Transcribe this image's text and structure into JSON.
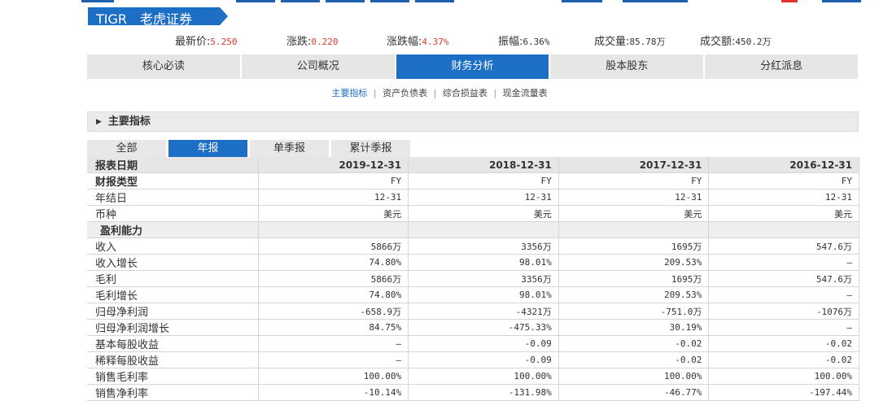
{
  "colors": {
    "accent": "#1d6ec5",
    "negative_red": "#e0392c",
    "tab_grey": "#e6e6e6"
  },
  "stock": {
    "symbol": "TIGR",
    "name": "老虎证券"
  },
  "quote": {
    "latest_label": "最新价:",
    "latest_value": "5.250",
    "change_label": "涨跌:",
    "change_value": "0.220",
    "pct_label": "涨跌幅:",
    "pct_value": "4.37%",
    "amplitude_label": "振幅:",
    "amplitude_value": "6.36%",
    "volume_label": "成交量:",
    "volume_value": "85.78万",
    "turnover_label": "成交额:",
    "turnover_value": "450.2万"
  },
  "nav": {
    "tabs": [
      "核心必读",
      "公司概况",
      "财务分析",
      "股本股东",
      "分红派息"
    ],
    "active": 2
  },
  "subnav": {
    "items": [
      "主要指标",
      "资产负债表",
      "综合损益表",
      "现金流量表"
    ],
    "separator": "|"
  },
  "section": {
    "title": "主要指标",
    "icon": "triangle-right-icon"
  },
  "period_tabs": [
    "全部",
    "年报",
    "单季报",
    "累计季报"
  ],
  "table": {
    "header": {
      "label": "报表日期",
      "cols": [
        "2019-12-31",
        "2018-12-31",
        "2017-12-31",
        "2016-12-31"
      ]
    },
    "rows": [
      {
        "label": "财报类型",
        "values": [
          "FY",
          "FY",
          "FY",
          "FY"
        ],
        "bold": true
      },
      {
        "label": "年结日",
        "values": [
          "12-31",
          "12-31",
          "12-31",
          "12-31"
        ]
      },
      {
        "label": "币种",
        "values": [
          "美元",
          "美元",
          "美元",
          "美元"
        ]
      },
      {
        "label": "盈利能力",
        "group": true
      },
      {
        "label": "收入",
        "values": [
          "5866万",
          "3356万",
          "1695万",
          "547.6万"
        ]
      },
      {
        "label": "收入增长",
        "values": [
          "74.80%",
          "98.01%",
          "209.53%",
          "—"
        ]
      },
      {
        "label": "毛利",
        "values": [
          "5866万",
          "3356万",
          "1695万",
          "547.6万"
        ]
      },
      {
        "label": "毛利增长",
        "values": [
          "74.80%",
          "98.01%",
          "209.53%",
          "—"
        ]
      },
      {
        "label": "归母净利润",
        "values": [
          "-658.9万",
          "-4321万",
          "-751.0万",
          "-1076万"
        ]
      },
      {
        "label": "归母净利润增长",
        "values": [
          "84.75%",
          "-475.33%",
          "30.19%",
          "—"
        ]
      },
      {
        "label": "基本每股收益",
        "values": [
          "—",
          "-0.09",
          "-0.02",
          "-0.02"
        ]
      },
      {
        "label": "稀释每股收益",
        "values": [
          "—",
          "-0.09",
          "-0.02",
          "-0.02"
        ]
      },
      {
        "label": "销售毛利率",
        "values": [
          "100.00%",
          "100.00%",
          "100.00%",
          "100.00%"
        ]
      },
      {
        "label": "销售净利率",
        "values": [
          "-10.14%",
          "-131.98%",
          "-46.77%",
          "-197.44%"
        ]
      }
    ]
  }
}
